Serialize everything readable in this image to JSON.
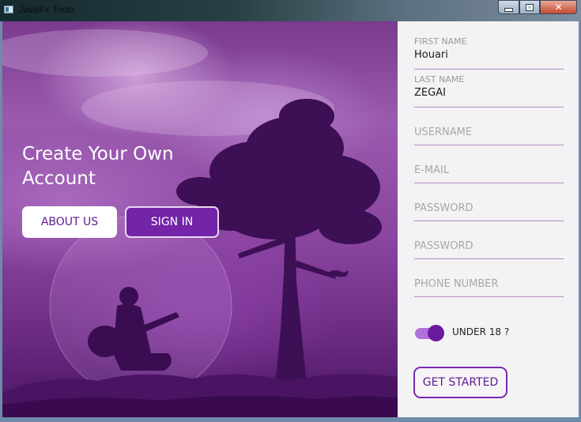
{
  "window": {
    "title": "JavaFx Tools",
    "controls": {
      "minimize_icon": "minimize-icon",
      "maximize_icon": "maximize-icon",
      "close_glyph": "✕"
    }
  },
  "hero": {
    "title": "Create Your Own Account",
    "about_label": "ABOUT US",
    "signin_label": "SIGN IN"
  },
  "form": {
    "first_name": {
      "label": "FIRST NAME",
      "value": "Houari"
    },
    "last_name": {
      "label": "LAST NAME",
      "value": "ZEGAI"
    },
    "username": {
      "placeholder": "USERNAME"
    },
    "email": {
      "placeholder": "E-MAIL"
    },
    "password": {
      "placeholder": "PASSWORD"
    },
    "password_confirm": {
      "placeholder": "PASSWORD"
    },
    "phone": {
      "placeholder": "PHONE NUMBER"
    },
    "under18": {
      "label": "UNDER 18 ?",
      "checked": true
    },
    "submit_label": "GET STARTED"
  },
  "colors": {
    "accent": "#6a1a9e",
    "toggle_track": "#b071d8",
    "field_line": "#b38ccb",
    "form_bg": "#f3f2f4"
  }
}
